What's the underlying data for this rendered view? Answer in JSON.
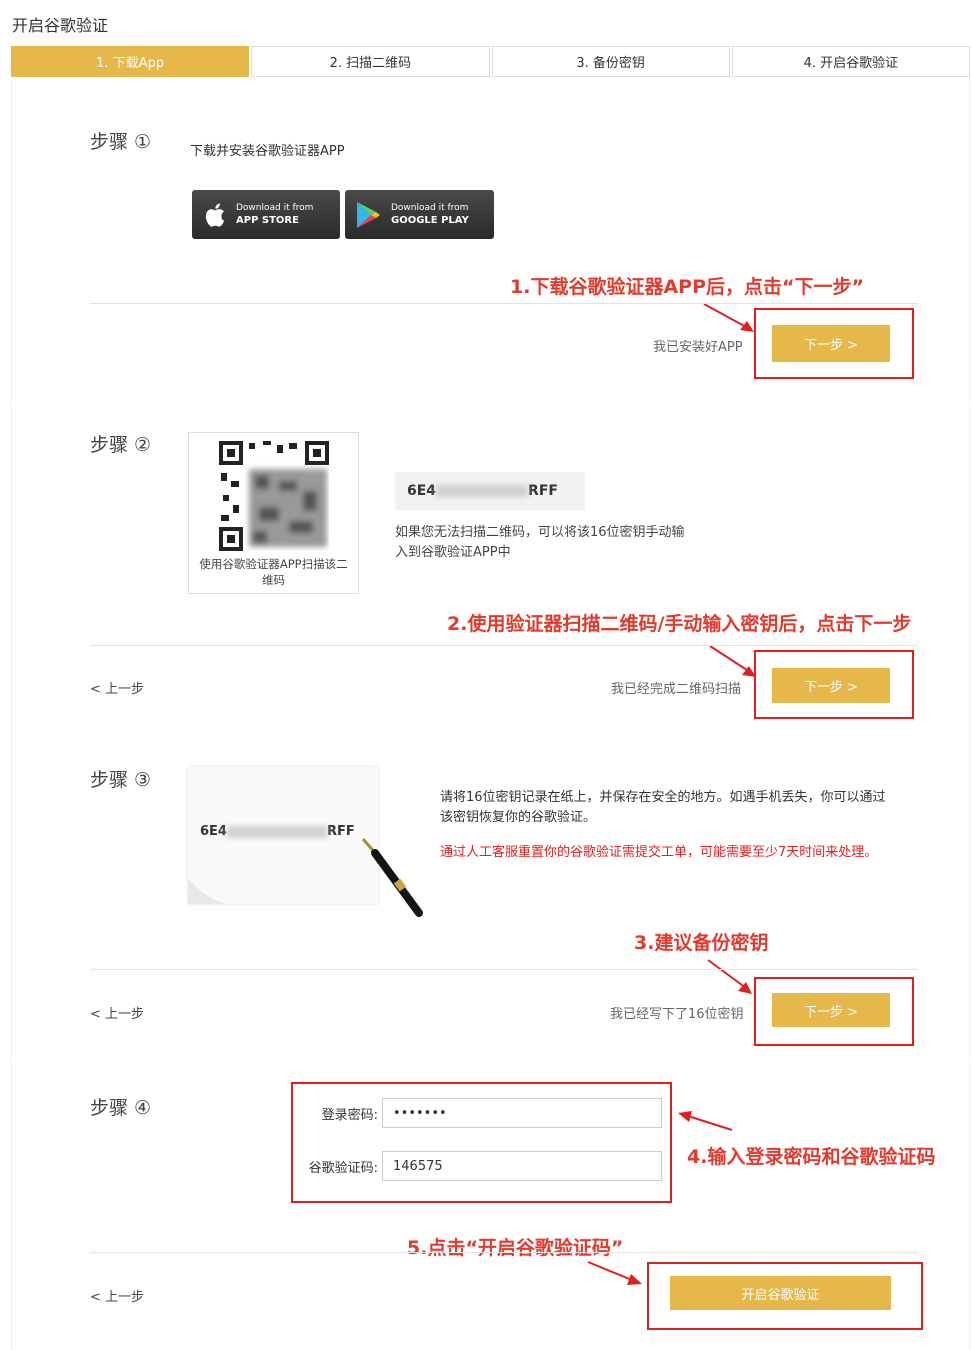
{
  "page_title": "开启谷歌验证",
  "tabs": [
    {
      "label": "1. 下载App",
      "active": true
    },
    {
      "label": "2. 扫描二维码",
      "active": false
    },
    {
      "label": "3. 备份密钥",
      "active": false
    },
    {
      "label": "4. 开启谷歌验证",
      "active": false
    }
  ],
  "step1": {
    "label": "步骤 ①",
    "desc": "下载并安装谷歌验证器APP",
    "appstore_small": "Download it from",
    "appstore_big": "APP STORE",
    "gplay_small": "Download it from",
    "gplay_big": "GOOGLE PLAY",
    "confirm_text": "我已安装好APP",
    "next_label": "下一步 >",
    "annotation": "1.下载谷歌验证器APP后，点击“下一步”"
  },
  "step2": {
    "label": "步骤 ②",
    "qr_caption": "使用谷歌验证器APP扫描该二维码",
    "key_prefix": "6E4",
    "key_suffix": "RFF",
    "hint": "如果您无法扫描二维码，可以将该16位密钥手动输入到谷歌验证APP中",
    "prev_label": "< 上一步",
    "confirm_text": "我已经完成二维码扫描",
    "next_label": "下一步 >",
    "annotation": "2.使用验证器扫描二维码/手动输入密钥后，点击下一步"
  },
  "step3": {
    "label": "步骤 ③",
    "key_prefix": "6E4",
    "key_suffix": "RFF",
    "instruction": "请将16位密钥记录在纸上，并保存在安全的地方。如遇手机丢失，你可以通过该密钥恢复你的谷歌验证。",
    "warning": "通过人工客服重置你的谷歌验证需提交工单，可能需要至少7天时间来处理。",
    "prev_label": "< 上一步",
    "confirm_text": "我已经写下了16位密钥",
    "next_label": "下一步 >",
    "annotation": "3.建议备份密钥"
  },
  "step4": {
    "label": "步骤 ④",
    "login_password_label": "登录密码:",
    "login_password_value": "•••••••",
    "google_code_label": "谷歌验证码:",
    "google_code_value": "146575",
    "annotation_inputs": "4.输入登录密码和谷歌验证码",
    "prev_label": "< 上一步",
    "enable_label": "开启谷歌验证",
    "annotation_enable": "5.点击“开启谷歌验证码”"
  },
  "colors": {
    "gold": "#e6b74b",
    "annotation_red": "#e33a2e",
    "warning_red": "#e02020"
  }
}
